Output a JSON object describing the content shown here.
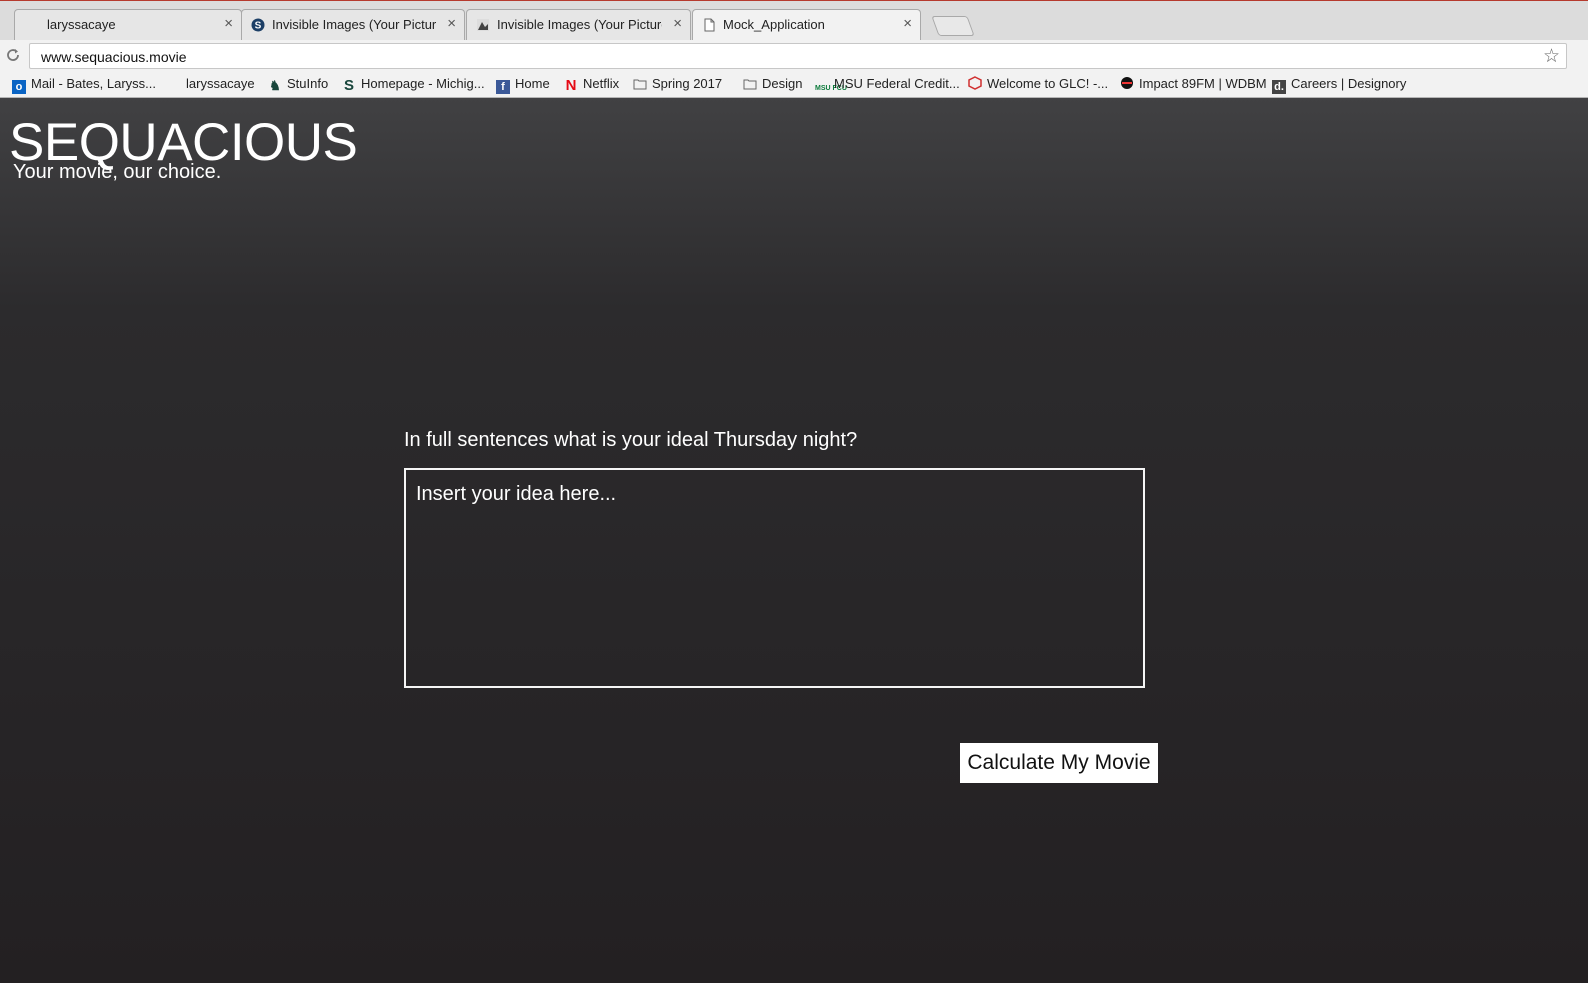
{
  "browser": {
    "tabs": [
      {
        "title": "laryssacaye",
        "icon": "blank-page-icon"
      },
      {
        "title": "Invisible Images (Your Pictures",
        "icon": "s-logo-icon"
      },
      {
        "title": "Invisible Images (Your Pictures",
        "icon": "image-site-icon"
      },
      {
        "title": "Mock_Application",
        "icon": "document-icon"
      }
    ],
    "tab_close_glyph": "×",
    "url": "www.sequacious.movie",
    "bookmarks": [
      {
        "label": "Mail - Bates, Laryss...",
        "icon": "outlook-icon"
      },
      {
        "label": "laryssacaye",
        "icon": "none"
      },
      {
        "label": "StuInfo",
        "icon": "spartan-icon"
      },
      {
        "label": "Homepage - Michig...",
        "icon": "msu-s-icon"
      },
      {
        "label": "Home",
        "icon": "facebook-icon"
      },
      {
        "label": "Netflix",
        "icon": "netflix-icon"
      },
      {
        "label": "Spring 2017",
        "icon": "folder-icon"
      },
      {
        "label": "Design",
        "icon": "folder-icon"
      },
      {
        "label": "MSU Federal Credit...",
        "icon": "msufcu-icon"
      },
      {
        "label": "Welcome to GLC! -...",
        "icon": "glc-icon"
      },
      {
        "label": "Impact 89FM | WDBM",
        "icon": "impact-icon"
      },
      {
        "label": "Careers | Designory",
        "icon": "designory-icon"
      }
    ]
  },
  "page": {
    "brand": {
      "title": "SEQUACIOUS",
      "tagline": "Your movie, our choice."
    },
    "form": {
      "question": "In full sentences what is your ideal Thursday night?",
      "placeholder": "Insert your idea here...",
      "submit_label": "Calculate My Movie"
    }
  },
  "colors": {
    "page_bg_top": "#414143",
    "page_bg_bottom": "#232022",
    "text": "#ffffff",
    "button_bg": "#ffffff"
  }
}
